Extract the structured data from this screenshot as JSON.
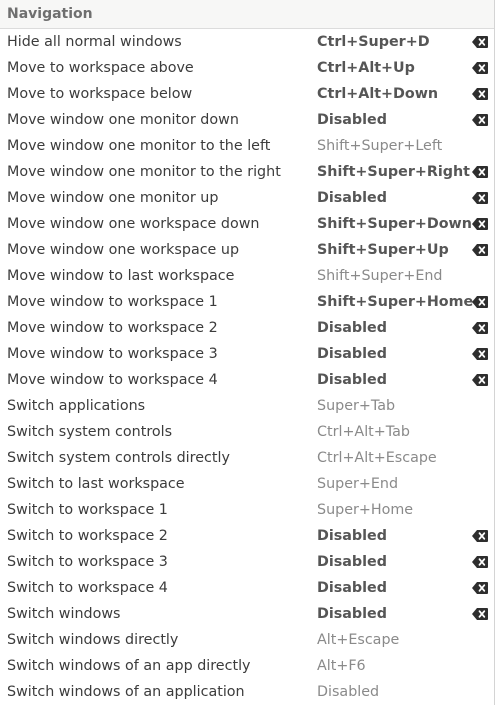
{
  "section": {
    "title": "Navigation"
  },
  "rows": [
    {
      "action": "Hide all normal windows",
      "accel": "Ctrl+Super+D",
      "custom": true
    },
    {
      "action": "Move to workspace above",
      "accel": "Ctrl+Alt+Up",
      "custom": true
    },
    {
      "action": "Move to workspace below",
      "accel": "Ctrl+Alt+Down",
      "custom": true
    },
    {
      "action": "Move window one monitor down",
      "accel": "Disabled",
      "custom": true
    },
    {
      "action": "Move window one monitor to the left",
      "accel": "Shift+Super+Left",
      "custom": false
    },
    {
      "action": "Move window one monitor to the right",
      "accel": "Shift+Super+Right",
      "custom": true
    },
    {
      "action": "Move window one monitor up",
      "accel": "Disabled",
      "custom": true
    },
    {
      "action": "Move window one workspace down",
      "accel": "Shift+Super+Down",
      "custom": true
    },
    {
      "action": "Move window one workspace up",
      "accel": "Shift+Super+Up",
      "custom": true
    },
    {
      "action": "Move window to last workspace",
      "accel": "Shift+Super+End",
      "custom": false
    },
    {
      "action": "Move window to workspace 1",
      "accel": "Shift+Super+Home",
      "custom": true
    },
    {
      "action": "Move window to workspace 2",
      "accel": "Disabled",
      "custom": true
    },
    {
      "action": "Move window to workspace 3",
      "accel": "Disabled",
      "custom": true
    },
    {
      "action": "Move window to workspace 4",
      "accel": "Disabled",
      "custom": true
    },
    {
      "action": "Switch applications",
      "accel": "Super+Tab",
      "custom": false
    },
    {
      "action": "Switch system controls",
      "accel": "Ctrl+Alt+Tab",
      "custom": false
    },
    {
      "action": "Switch system controls directly",
      "accel": "Ctrl+Alt+Escape",
      "custom": false
    },
    {
      "action": "Switch to last workspace",
      "accel": "Super+End",
      "custom": false
    },
    {
      "action": "Switch to workspace 1",
      "accel": "Super+Home",
      "custom": false
    },
    {
      "action": "Switch to workspace 2",
      "accel": "Disabled",
      "custom": true
    },
    {
      "action": "Switch to workspace 3",
      "accel": "Disabled",
      "custom": true
    },
    {
      "action": "Switch to workspace 4",
      "accel": "Disabled",
      "custom": true
    },
    {
      "action": "Switch windows",
      "accel": "Disabled",
      "custom": true
    },
    {
      "action": "Switch windows directly",
      "accel": "Alt+Escape",
      "custom": false
    },
    {
      "action": "Switch windows of an app directly",
      "accel": "Alt+F6",
      "custom": false
    },
    {
      "action": "Switch windows of an application",
      "accel": "Disabled",
      "custom": false
    }
  ],
  "icons": {
    "reset": "backspace-clear-icon"
  }
}
